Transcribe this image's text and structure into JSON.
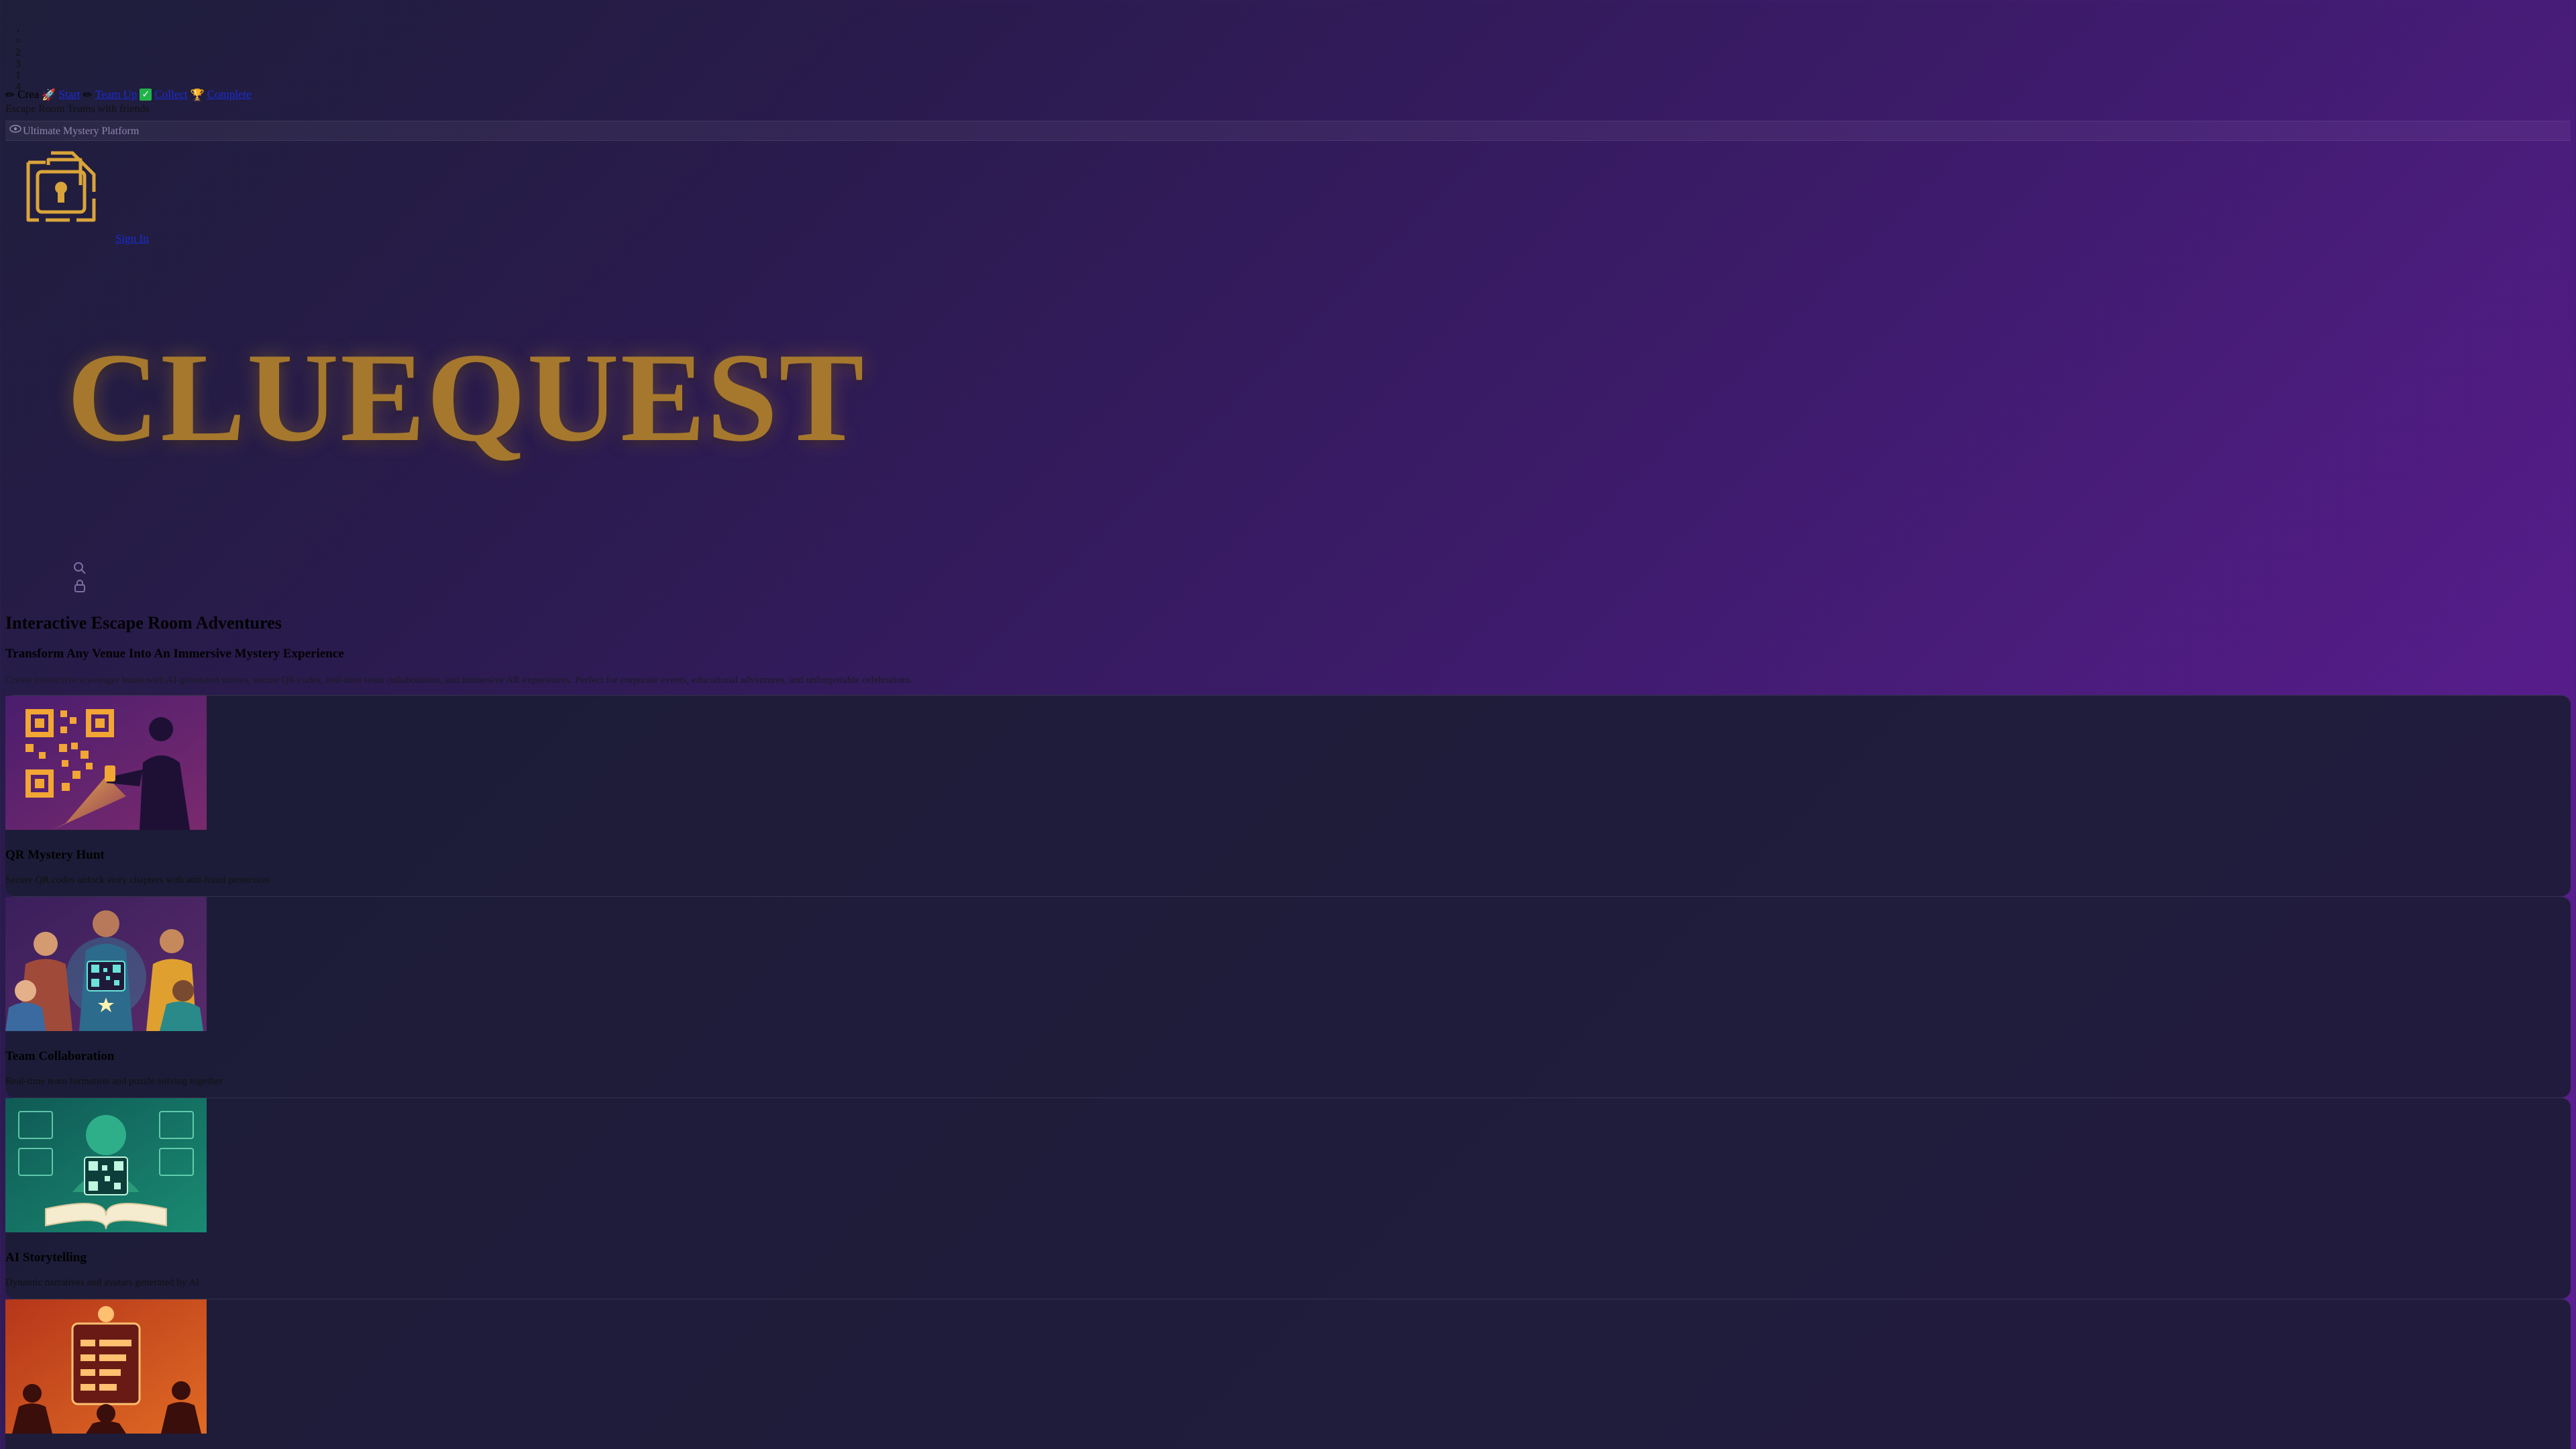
{
  "vertical_marks": [
    "‹",
    "=",
    "2",
    "3",
    "1",
    "4"
  ],
  "nav": {
    "items": [
      {
        "icon": "pencil-icon",
        "label": "Crea"
      },
      {
        "icon": "rocket-icon",
        "label": "Start"
      },
      {
        "icon": "pencil-icon",
        "label": "Team Up"
      },
      {
        "icon": "check-icon",
        "label": "Collect"
      },
      {
        "icon": "trophy-icon",
        "label": "Complete"
      }
    ],
    "subtext": "Escape Room Teams with friends"
  },
  "band": {
    "label": "Ultimate Mystery Platform"
  },
  "signin_label": "Sign In",
  "hero": {
    "title": "CLUEQUEST",
    "heading": "Interactive Escape Room Adventures",
    "subheading": "Transform Any Venue Into An Immersive Mystery Experience",
    "description": "Create interactive scavenger hunts with AI-generated stories, secure QR codes, real-time team collaboration, and immersive AR experiences. Perfect for corporate events, educational adventures, and unforgettable celebrations."
  },
  "features": [
    {
      "title": "QR Mystery Hunt",
      "subtitle": "Secure QR codes unlock story chapters with anti-fraud protection",
      "image": "qr-hunt-illustration",
      "accent": "#f0a830"
    },
    {
      "title": "Team Collaboration",
      "subtitle": "Real-time team formation and puzzle solving together",
      "image": "team-illustration",
      "accent": "#2fc7c2"
    },
    {
      "title": "AI Storytelling",
      "subtitle": "Dynamic narratives and avatars generated by AI",
      "image": "ai-story-illustration",
      "accent": "#46c99a"
    },
    {
      "title": "",
      "subtitle": "",
      "image": "leaderboard-illustration",
      "accent": "#f06a2a"
    }
  ],
  "colors": {
    "gold": "#a5782d",
    "link": "#1a2bd6",
    "card_bg": "#1c1c36"
  }
}
